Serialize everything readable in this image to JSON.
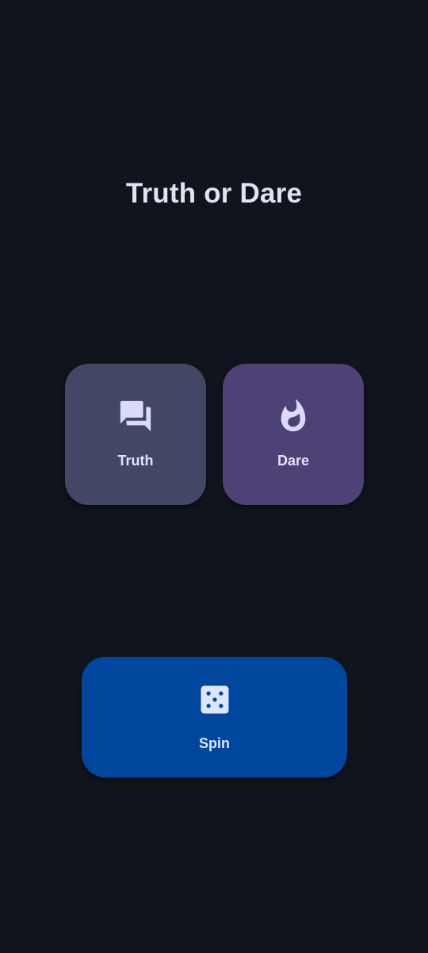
{
  "app": {
    "title": "Truth or Dare"
  },
  "choices": [
    {
      "label": "Truth",
      "icon": "chat-bubbles-icon",
      "color": "#434766"
    },
    {
      "label": "Dare",
      "icon": "flame-icon",
      "color": "#4e4175"
    }
  ],
  "spin": {
    "label": "Spin",
    "icon": "dice-icon",
    "color": "#00469c"
  },
  "colors": {
    "background": "#10141c",
    "title_text": "#dfe3f2",
    "label_text": "#e4e2fb"
  }
}
